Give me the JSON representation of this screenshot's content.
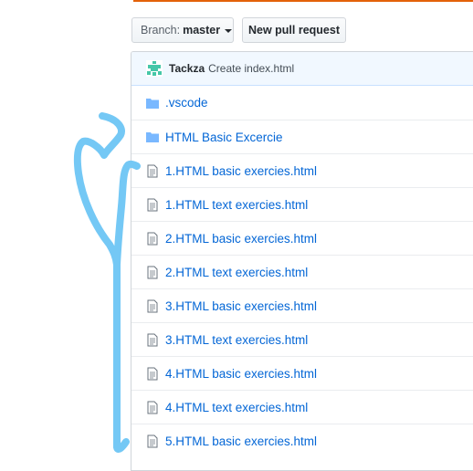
{
  "toolbar": {
    "branch_prefix": "Branch:",
    "branch_name": "master",
    "new_pr_label": "New pull request"
  },
  "commit": {
    "author": "Tackza",
    "message": "Create index.html"
  },
  "files": [
    {
      "type": "folder",
      "name": ".vscode"
    },
    {
      "type": "folder",
      "name": "HTML Basic Excercie"
    },
    {
      "type": "file",
      "name": "1.HTML basic exercies.html"
    },
    {
      "type": "file",
      "name": "1.HTML text exercies.html"
    },
    {
      "type": "file",
      "name": "2.HTML basic exercies.html"
    },
    {
      "type": "file",
      "name": "2.HTML text exercies.html"
    },
    {
      "type": "file",
      "name": "3.HTML basic exercies.html"
    },
    {
      "type": "file",
      "name": "3.HTML text exercies.html"
    },
    {
      "type": "file",
      "name": "4.HTML basic exercies.html"
    },
    {
      "type": "file",
      "name": "4.HTML text exercies.html"
    },
    {
      "type": "file",
      "name": "5.HTML basic exercies.html"
    }
  ],
  "colors": {
    "link": "#0366d6",
    "folder_icon": "#79b8ff",
    "annotation": "#74c8f5",
    "accent_bar": "#e36209"
  }
}
